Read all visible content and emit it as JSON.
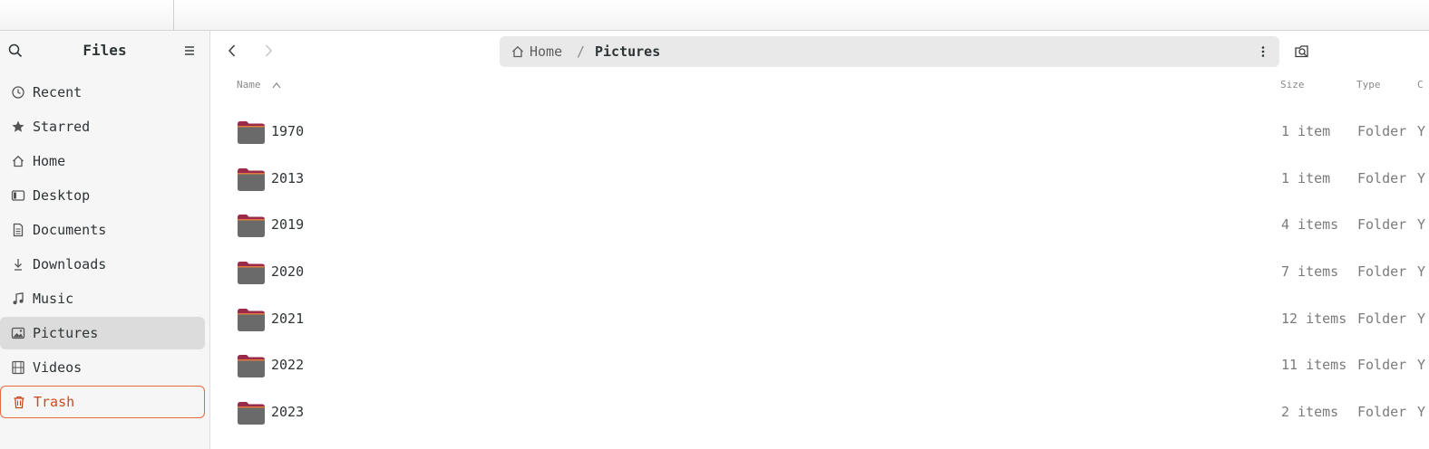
{
  "sidebar": {
    "title": "Files",
    "items": [
      {
        "label": "Recent",
        "icon": "clock-icon"
      },
      {
        "label": "Starred",
        "icon": "star-icon"
      },
      {
        "label": "Home",
        "icon": "home-icon"
      },
      {
        "label": "Desktop",
        "icon": "desktop-icon"
      },
      {
        "label": "Documents",
        "icon": "document-icon"
      },
      {
        "label": "Downloads",
        "icon": "download-icon"
      },
      {
        "label": "Music",
        "icon": "music-icon"
      },
      {
        "label": "Pictures",
        "icon": "image-icon",
        "active": true
      },
      {
        "label": "Videos",
        "icon": "film-icon"
      },
      {
        "label": "Trash",
        "icon": "trash-icon",
        "highlight": "#e46b3f"
      }
    ]
  },
  "pathbar": {
    "home_label": "Home",
    "separator": "/",
    "current": "Pictures"
  },
  "columns": {
    "name": "Name",
    "size": "Size",
    "type": "Type",
    "extra": "C"
  },
  "files": [
    {
      "name": "1970",
      "size": "1 item",
      "type": "Folder",
      "extra": "Y"
    },
    {
      "name": "2013",
      "size": "1 item",
      "type": "Folder",
      "extra": "Y"
    },
    {
      "name": "2019",
      "size": "4 items",
      "type": "Folder",
      "extra": "Y"
    },
    {
      "name": "2020",
      "size": "7 items",
      "type": "Folder",
      "extra": "Y"
    },
    {
      "name": "2021",
      "size": "12 items",
      "type": "Folder",
      "extra": "Y"
    },
    {
      "name": "2022",
      "size": "11 items",
      "type": "Folder",
      "extra": "Y"
    },
    {
      "name": "2023",
      "size": "2 items",
      "type": "Folder",
      "extra": "Y"
    }
  ],
  "colors": {
    "accent": "#e46b3f",
    "folder_body": "#6a6a6a",
    "folder_tab": "#9a2a4a"
  }
}
